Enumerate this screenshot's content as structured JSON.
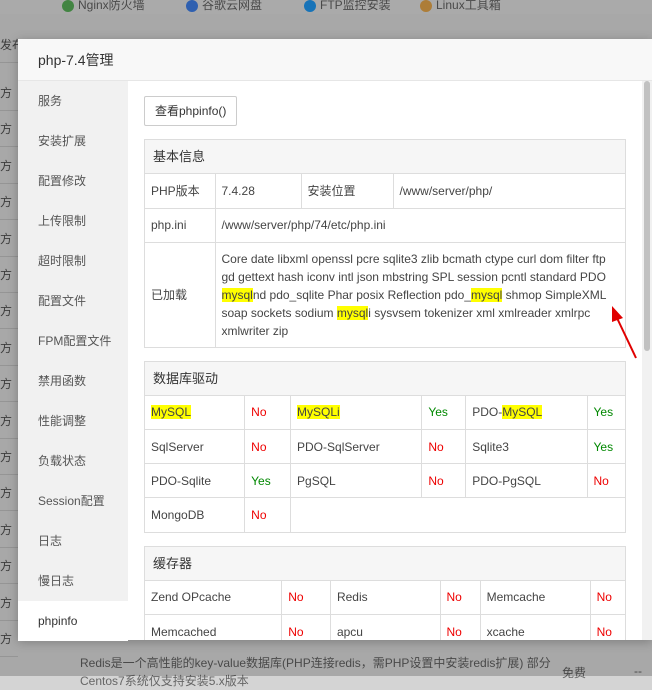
{
  "background": {
    "bookmarks": [
      "Nginx防火墙",
      "谷歌云网盘",
      "FTP监控安装",
      "Linux工具箱"
    ],
    "side_labels": [
      "发布",
      "方",
      "方",
      "方",
      "方",
      "方",
      "方",
      "方",
      "方",
      "方",
      "方",
      "方",
      "方",
      "方",
      "方",
      "方",
      "方"
    ],
    "bottom_text": "Redis是一个高性能的key-value数据库(PHP连接redis，需PHP设置中安装redis扩展) 部分Centos7系统仅支持安装5.x版本",
    "free_label": "免费",
    "dash": "--"
  },
  "modal": {
    "title": "php-7.4管理",
    "sidebar": [
      "服务",
      "安装扩展",
      "配置修改",
      "上传限制",
      "超时限制",
      "配置文件",
      "FPM配置文件",
      "禁用函数",
      "性能调整",
      "负载状态",
      "Session配置",
      "日志",
      "慢日志",
      "phpinfo"
    ],
    "active_index": 13,
    "phpinfo_button": "查看phpinfo()",
    "basic": {
      "title": "基本信息",
      "php_version_label": "PHP版本",
      "php_version": "7.4.28",
      "install_path_label": "安装位置",
      "install_path": "/www/server/php/",
      "php_ini_label": "php.ini",
      "php_ini": "/www/server/php/74/etc/php.ini",
      "loaded_label": "已加载",
      "loaded_parts": [
        "Core date libxml openssl pcre sqlite3 zlib bcmath ctype curl dom filter ftp gd gettext hash iconv intl json mbstring SPL session pcntl standard PDO ",
        "mysql",
        "nd pdo_sqlite Phar posix Reflection pdo_",
        "mysql",
        " shmop SimpleXML soap sockets sodium ",
        "mysql",
        "i sysvsem tokenizer xml xmlreader xmlrpc xmlwriter zip"
      ]
    },
    "db": {
      "title": "数据库驱动",
      "rows": [
        [
          {
            "name": "MySQL",
            "hl": "MySQL",
            "status": "No"
          },
          {
            "name": "MySQLi",
            "hl": "MySQL",
            "rest": "i",
            "status": "Yes"
          },
          {
            "prefix": "PDO-",
            "hl": "MySQL",
            "status": "Yes"
          }
        ],
        [
          {
            "name": "SqlServer",
            "status": "No"
          },
          {
            "name": "PDO-SqlServer",
            "status": "No"
          },
          {
            "name": "Sqlite3",
            "status": "Yes"
          }
        ],
        [
          {
            "name": "PDO-Sqlite",
            "status": "Yes"
          },
          {
            "name": "PgSQL",
            "status": "No"
          },
          {
            "name": "PDO-PgSQL",
            "status": "No"
          }
        ],
        [
          {
            "name": "MongoDB",
            "status": "No"
          }
        ]
      ]
    },
    "cache": {
      "title": "缓存器",
      "rows": [
        [
          {
            "name": "Zend OPcache",
            "status": "No"
          },
          {
            "name": "Redis",
            "status": "No"
          },
          {
            "name": "Memcache",
            "status": "No"
          }
        ],
        [
          {
            "name": "Memcached",
            "status": "No"
          },
          {
            "name": "apcu",
            "status": "No"
          },
          {
            "name": "xcache",
            "status": "No"
          }
        ]
      ]
    }
  },
  "colors": {
    "yes": "#008000",
    "no": "#e00000",
    "highlight": "#ffff00",
    "arrow": "#e00000"
  }
}
